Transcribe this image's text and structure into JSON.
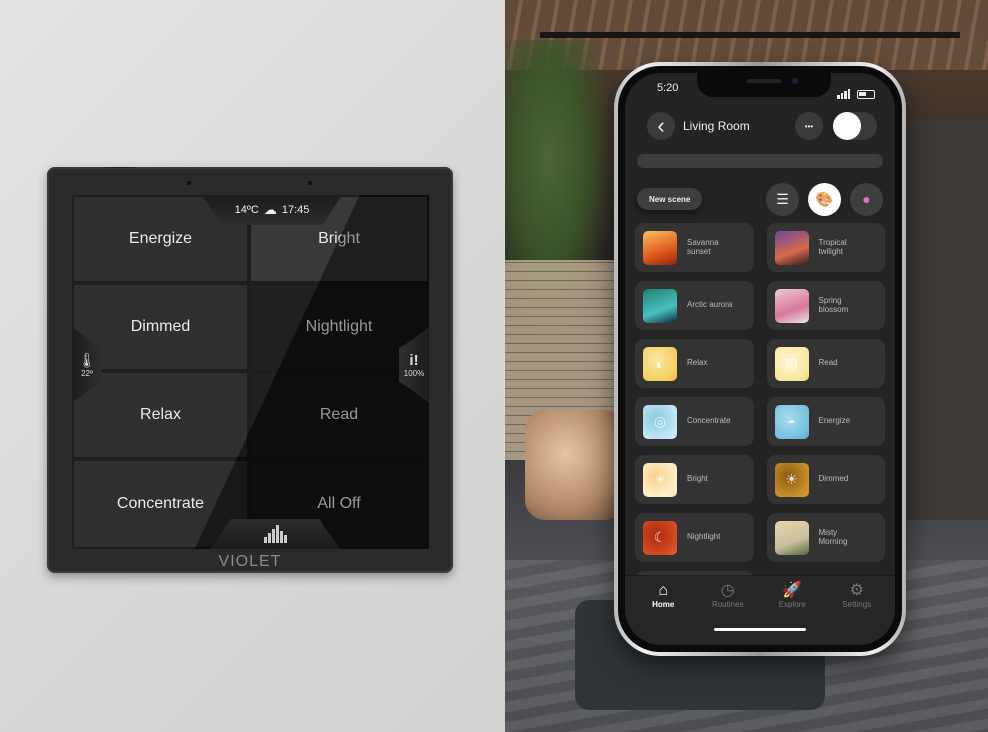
{
  "panel": {
    "weather": {
      "temperature": "14ºC",
      "icon": "cloudy-sun-icon",
      "time": "17:45"
    },
    "left_side": {
      "icon": "thermometer-icon",
      "value": "22º"
    },
    "right_side": {
      "icon": "info-alert-icon",
      "value": "100%"
    },
    "bottom_icon": "equalizer-icon",
    "brand": "VIOLET",
    "scenes": [
      "Energize",
      "Bright",
      "Dimmed",
      "Nightlight",
      "Relax",
      "Read",
      "Concentrate",
      "All Off"
    ]
  },
  "phone": {
    "status": {
      "time": "5:20"
    },
    "header": {
      "title": "Living Room",
      "back_icon": "‹",
      "more_icon": "•••",
      "power_on": true
    },
    "new_scene_label": "New scene",
    "view_buttons": [
      {
        "name": "list-view",
        "glyph": "☰",
        "active": false
      },
      {
        "name": "palette-view",
        "glyph": "🎨",
        "active": true
      },
      {
        "name": "color-pin-view",
        "glyph": "◉",
        "active": false
      }
    ],
    "scenes": [
      {
        "label": "Savanna\nsunset",
        "colors": [
          "#f6c060",
          "#e05a1e",
          "#8c2410"
        ]
      },
      {
        "label": "Tropical\ntwilight",
        "colors": [
          "#6a4a9a",
          "#d86a4a",
          "#2a1a20"
        ]
      },
      {
        "label": "Arctic aurora",
        "colors": [
          "#1e8070",
          "#4ac0c0",
          "#102838"
        ]
      },
      {
        "label": "Spring\nblossom",
        "colors": [
          "#f0c8d8",
          "#d8789a",
          "#e8e8f0"
        ]
      },
      {
        "label": "Relax",
        "colors": [
          "#f8d060",
          "#f8e8a8",
          "#f0b840"
        ]
      },
      {
        "label": "Read",
        "colors": [
          "#f8e8a0",
          "#fff4d0",
          "#f0d070"
        ]
      },
      {
        "label": "Concentrate",
        "colors": [
          "#bfe8f4",
          "#88c8e0",
          "#d8f0f8"
        ]
      },
      {
        "label": "Energize",
        "colors": [
          "#78c0e0",
          "#a8dcf0",
          "#5aa8d0"
        ]
      },
      {
        "label": "Bright",
        "colors": [
          "#fff0c8",
          "#f8d088",
          "#fce8b0"
        ]
      },
      {
        "label": "Dimmed",
        "colors": [
          "#c89028",
          "#8a5a10",
          "#d8a040"
        ]
      },
      {
        "label": "Nightlight",
        "colors": [
          "#d84a20",
          "#a82a10",
          "#e86030"
        ]
      },
      {
        "label": "Misty\nMorning",
        "colors": [
          "#e8d8a8",
          "#c8c0a0",
          "#506838"
        ]
      }
    ],
    "scene_icons": [
      "photo",
      "photo",
      "photo",
      "photo",
      "◐",
      "▤",
      "◎",
      "◓",
      "☀",
      "☀",
      "☾",
      "photo"
    ],
    "tabs": [
      {
        "label": "Home",
        "icon": "⌂",
        "active": true
      },
      {
        "label": "Routines",
        "icon": "◷",
        "active": false
      },
      {
        "label": "Explore",
        "icon": "🚀",
        "active": false
      },
      {
        "label": "Settings",
        "icon": "⚙",
        "active": false
      }
    ]
  }
}
